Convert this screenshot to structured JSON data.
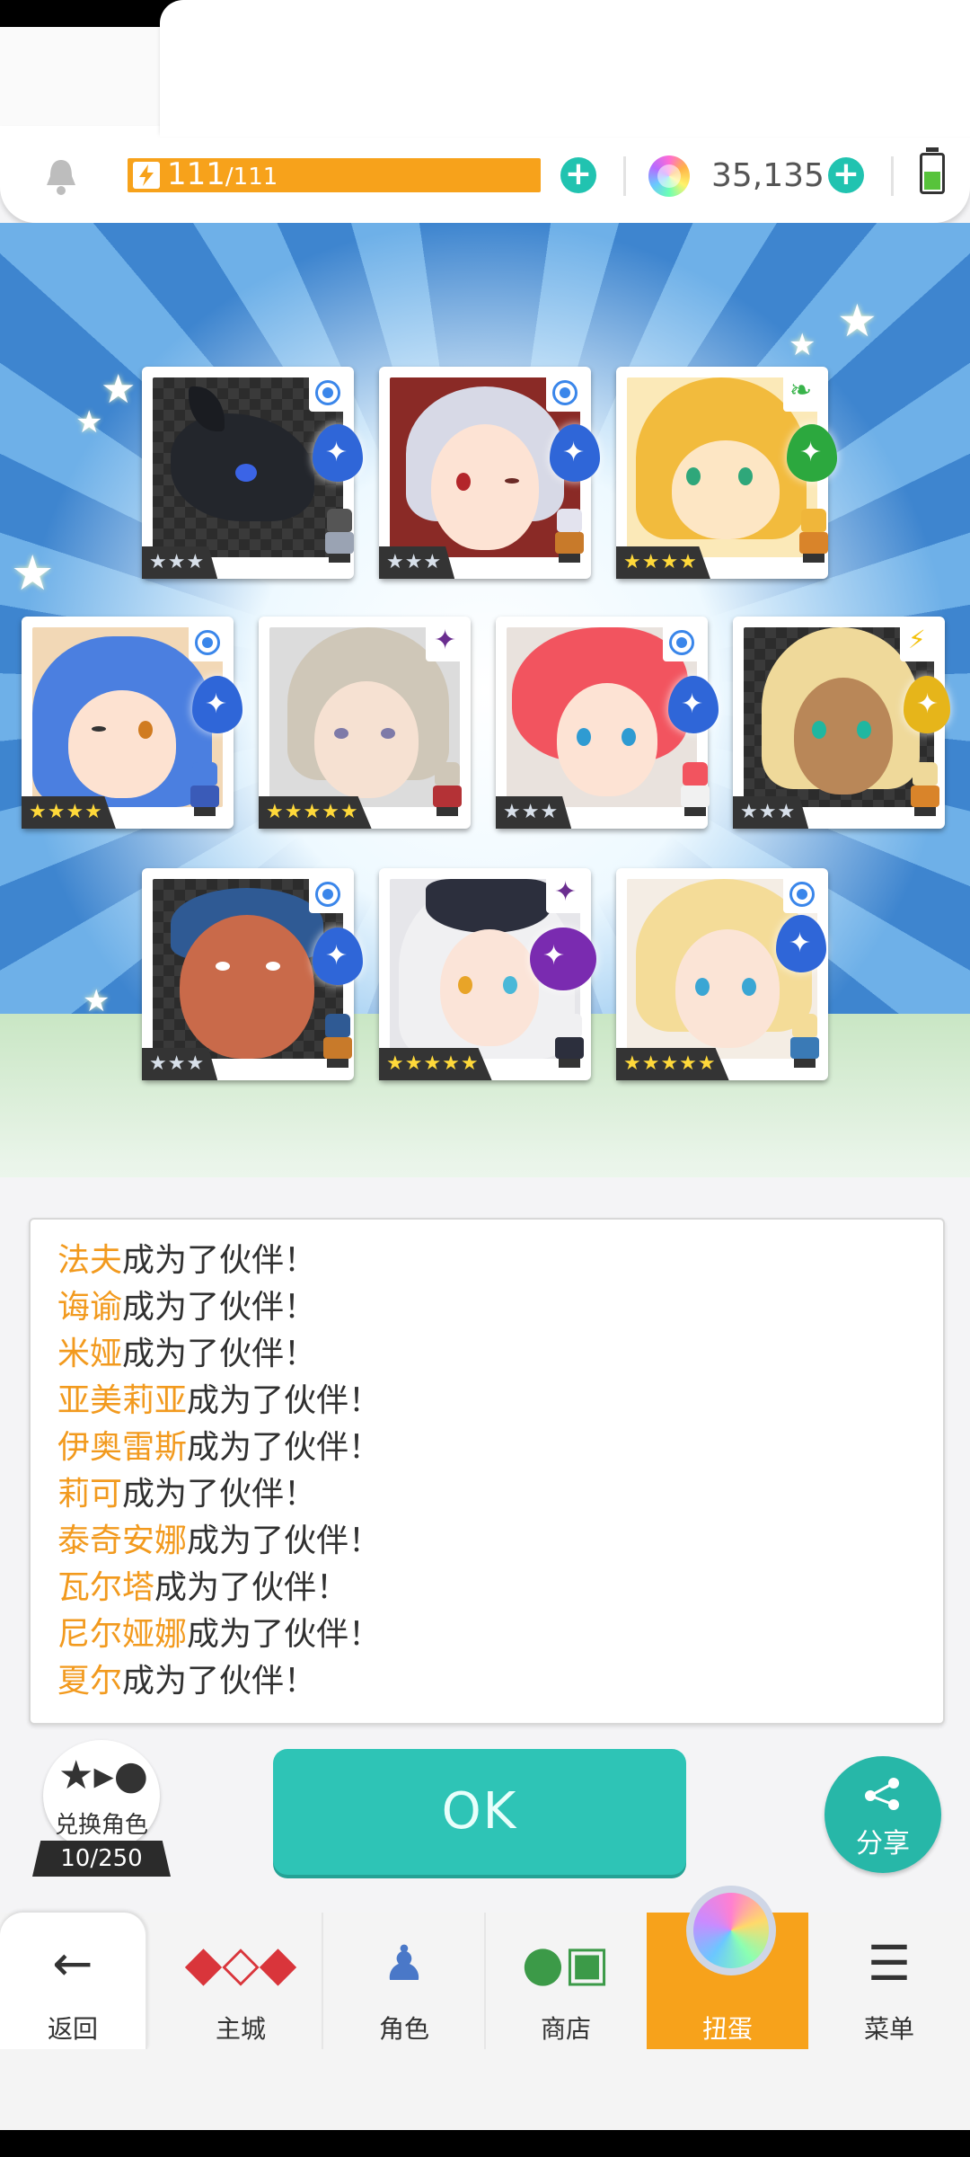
{
  "header": {
    "energy_current": "111",
    "energy_sep": "/",
    "energy_max": "111",
    "energy_fraction": 1.0,
    "gems": "35,135",
    "icons": [
      "bell-icon",
      "lightning-icon",
      "plus-icon",
      "rainbow-gem-icon",
      "battery-icon"
    ],
    "colors": {
      "energy": "#f7a21b",
      "plus": "#21c3b0"
    }
  },
  "cards": [
    {
      "element": "water",
      "stars": "★★★",
      "rarity": 3
    },
    {
      "element": "water",
      "stars": "★★★",
      "rarity": 3
    },
    {
      "element": "leaf",
      "stars": "★★★★",
      "rarity": 4
    },
    {
      "element": "water",
      "stars": "★★★★",
      "rarity": 4
    },
    {
      "element": "dark",
      "stars": "★★★★★",
      "rarity": 5
    },
    {
      "element": "water",
      "stars": "★★★",
      "rarity": 3
    },
    {
      "element": "lightning",
      "stars": "★★★",
      "rarity": 3
    },
    {
      "element": "water",
      "stars": "★★★",
      "rarity": 3
    },
    {
      "element": "dark",
      "stars": "★★★★★",
      "rarity": 5
    },
    {
      "element": "water",
      "stars": "★★★★★",
      "rarity": 5
    }
  ],
  "messages": [
    {
      "name": "法夫",
      "text": "成为了伙伴！"
    },
    {
      "name": "诲谕",
      "text": "成为了伙伴！"
    },
    {
      "name": "米娅",
      "text": "成为了伙伴！"
    },
    {
      "name": "亚美莉亚",
      "text": "成为了伙伴！"
    },
    {
      "name": "伊奥雷斯",
      "text": "成为了伙伴！"
    },
    {
      "name": "莉可",
      "text": "成为了伙伴！"
    },
    {
      "name": "泰奇安娜",
      "text": "成为了伙伴！"
    },
    {
      "name": "瓦尔塔",
      "text": "成为了伙伴！"
    },
    {
      "name": "尼尔娅娜",
      "text": "成为了伙伴！"
    },
    {
      "name": "夏尔",
      "text": "成为了伙伴！"
    }
  ],
  "actions": {
    "exchange_label": "兑换角色",
    "exchange_count": "10/250",
    "ok_label": "OK",
    "share_label": "分享"
  },
  "nav": {
    "back": "返回",
    "items": [
      "主城",
      "角色",
      "商店",
      "扭蛋",
      "菜单"
    ],
    "active": "扭蛋",
    "active_color": "#f7a21b"
  }
}
